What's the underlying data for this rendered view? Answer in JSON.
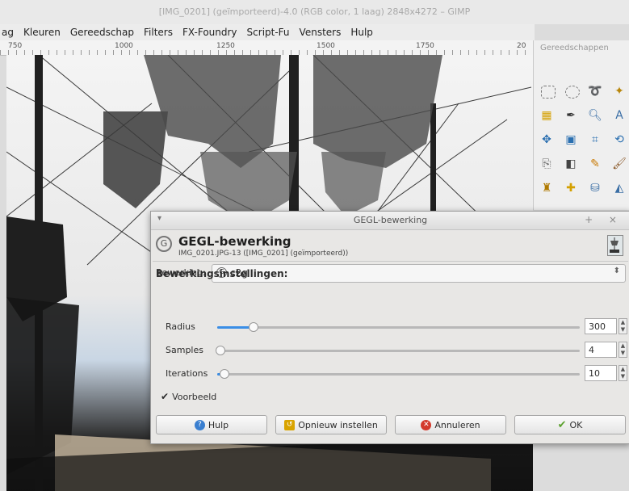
{
  "window": {
    "title": "[IMG_0201] (geïmporteerd)-4.0 (RGB color, 1 laag) 2848x4272 – GIMP"
  },
  "menubar": [
    "ag",
    "Kleuren",
    "Gereedschap",
    "Filters",
    "FX-Foundry",
    "Script-Fu",
    "Vensters",
    "Hulp"
  ],
  "ruler": [
    "750",
    "1000",
    "1250",
    "1500",
    "1750",
    "20"
  ],
  "toolbox": {
    "title": "Gereedschappen",
    "tools": [
      "rect-select-icon",
      "ellipse-select-icon",
      "lasso-icon",
      "magic-wand-icon",
      "color-select-icon",
      "color-picker-icon",
      "zoom-icon",
      "measure-icon",
      "move-icon",
      "align-icon",
      "crop-icon",
      "rotate-icon",
      "clone-icon",
      "eraser-icon",
      "pencil-icon",
      "paintbrush-icon",
      "stamp-icon",
      "heal-icon",
      "bucket-icon",
      "dodge-icon"
    ]
  },
  "dialog": {
    "window_title": "GEGL-bewerking",
    "menu_glyph": "▾",
    "controls": "+ ×",
    "header_title": "GEGL-bewerking",
    "header_subtitle": "IMG_0201.JPG-13 ([IMG_0201] (geïmporteerd))",
    "operation_label": "Bewerking:",
    "operation_value": "c2g",
    "section_title": "Bewerkingsinstellingen:",
    "params": [
      {
        "label": "Radius",
        "value": "300",
        "fraction": 0.1
      },
      {
        "label": "Samples",
        "value": "4",
        "fraction": 0.01
      },
      {
        "label": "Iterations",
        "value": "10",
        "fraction": 0.02
      }
    ],
    "preview_label": "Voorbeeld",
    "preview_checked": true,
    "buttons": {
      "help": "Hulp",
      "reset": "Opnieuw instellen",
      "cancel": "Annuleren",
      "ok": "OK"
    }
  }
}
